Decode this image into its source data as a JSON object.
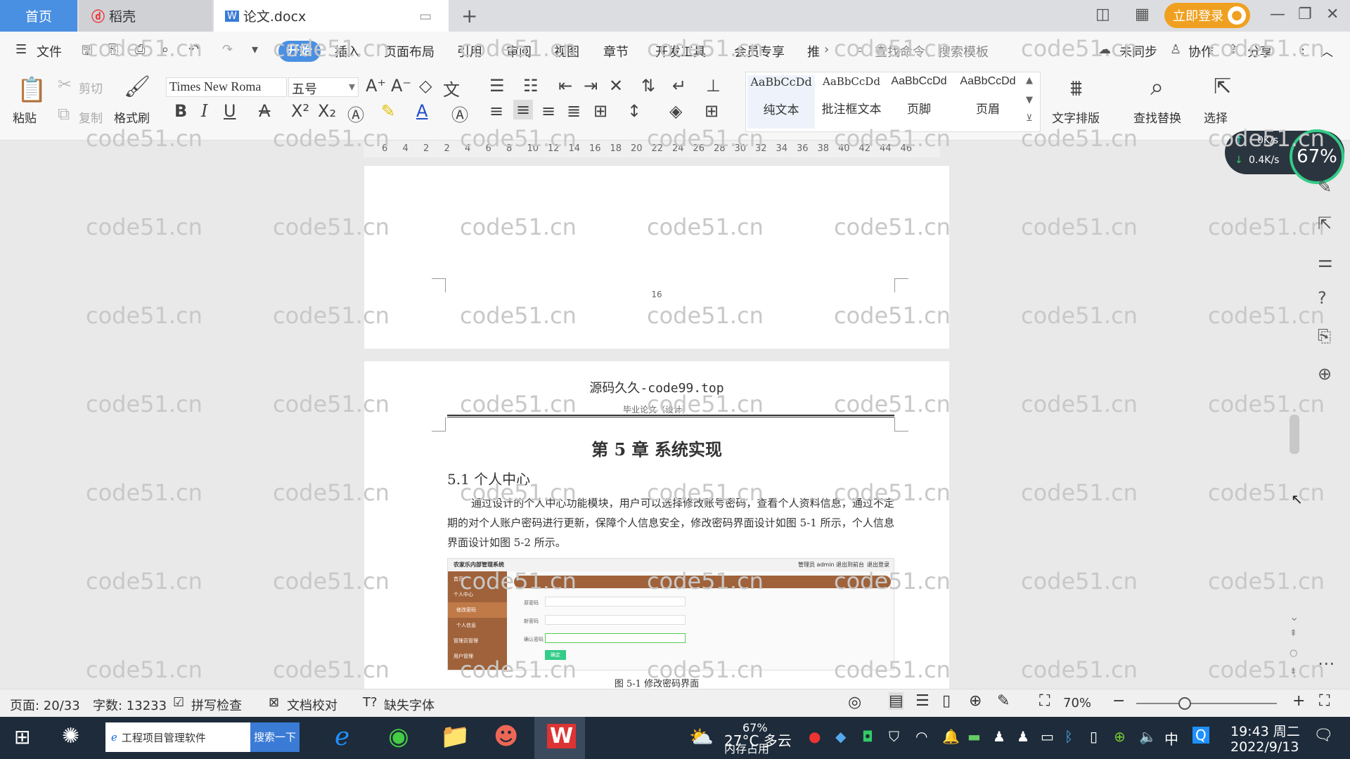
{
  "tabs": {
    "home": "首页",
    "docer": "稻壳",
    "doc": "论文.docx"
  },
  "login": "立即登录",
  "menu": [
    "文件",
    "开始",
    "插入",
    "页面布局",
    "引用",
    "审阅",
    "视图",
    "章节",
    "开发工具",
    "会员专享",
    "推"
  ],
  "search": {
    "placeholder": "查找命令、搜索模板"
  },
  "sync": "未同步",
  "collab": "协作",
  "share": "分享",
  "toolbar": {
    "paste": "粘贴",
    "cut": "剪切",
    "copy": "复制",
    "format_painter": "格式刷",
    "font": "Times New Roma",
    "size": "五号",
    "text_layout": "文字排版",
    "find_replace": "查找替换",
    "select": "选择"
  },
  "styles": [
    {
      "sample": "AaBbCcDd",
      "label": "纯文本"
    },
    {
      "sample": "AaBbCcDd",
      "label": "批注框文本"
    },
    {
      "sample": "AaBbCcDd",
      "label": "页脚"
    },
    {
      "sample": "AaBbCcDd",
      "label": "页眉"
    }
  ],
  "ruler": [
    "6",
    "4",
    "2",
    "2",
    "4",
    "6",
    "8",
    "10",
    "12",
    "14",
    "16",
    "18",
    "20",
    "22",
    "24",
    "26",
    "28",
    "30",
    "32",
    "34",
    "36",
    "38",
    "40",
    "42",
    "44",
    "46"
  ],
  "netspeed": {
    "up": "0K/s",
    "down": "0.4K/s",
    "percent": "67%"
  },
  "page1": {
    "number": "16"
  },
  "page2": {
    "header_site": "源码久久-code99.top",
    "header_sub": "毕业论文（设计）",
    "chapter": "第 5 章  系统实现",
    "section": "5.1 个人中心",
    "paragraph": "通过设计的个人中心功能模块，用户可以选择修改账号密码，查看个人资料信息，通过不定期的对个人账户密码进行更新，保障个人信息安全，修改密码界面设计如图 5-1 所示，个人信息界面设计如图 5-2 所示。",
    "figure_caption": "图 5-1 修改密码界面",
    "figure": {
      "title": "农家乐内部管理系统",
      "top_links": [
        "管理员 admin",
        "退出到前台",
        "退出登录"
      ],
      "side": [
        "首页",
        "个人中心",
        "修改密码",
        "个人信息",
        "管理员管理",
        "用户管理"
      ],
      "fields": [
        "原密码",
        "新密码",
        "确认密码"
      ],
      "button": "确定"
    }
  },
  "watermark": "code51.cn",
  "status": {
    "page": "页面: 20/33",
    "words": "字数: 13233",
    "spell": "拼写检查",
    "proof": "文档校对",
    "missing_font": "缺失字体",
    "zoom": "70%"
  },
  "taskbar": {
    "app": "工程项目管理软件",
    "search_btn": "搜索一下",
    "weather": "27°C 多云",
    "mem": "67%",
    "mem_label": "内存占用",
    "ime": "中",
    "time": "19:43 周二",
    "date": "2022/9/13"
  }
}
